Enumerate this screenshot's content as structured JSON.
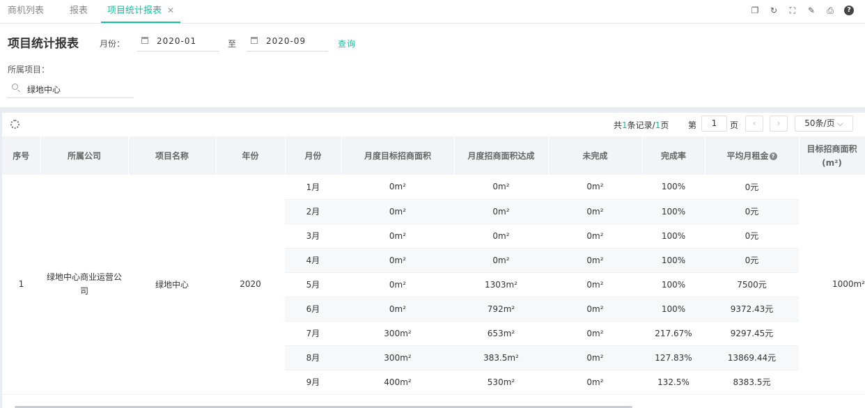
{
  "tabs": [
    {
      "label": "商机列表",
      "active": false
    },
    {
      "label": "报表",
      "active": false
    },
    {
      "label": "项目统计报表",
      "active": true
    }
  ],
  "toolbar_icons": [
    "copy-icon",
    "refresh-icon",
    "fullscreen-icon",
    "edit-icon",
    "print-icon",
    "help-icon"
  ],
  "filter": {
    "title": "项目统计报表",
    "month_label": "月份：",
    "start_month": "2020-01",
    "to_label": "至",
    "end_month": "2020-09",
    "query_label": "查询",
    "project_label": "所属项目：",
    "project_value": "绿地中心"
  },
  "pager": {
    "total_prefix": "共",
    "total_records": "1",
    "records_suffix": "条记录/",
    "total_pages": "1",
    "pages_suffix": "页",
    "page_prefix": "第",
    "current_page": "1",
    "page_suffix": "页",
    "page_size": "50条/页"
  },
  "columns": [
    "序号",
    "所属公司",
    "项目名称",
    "年份",
    "月份",
    "月度目标招商面积",
    "月度招商面积达成",
    "未完成",
    "完成率",
    "平均月租金",
    "目标招商面积(m²)"
  ],
  "group": {
    "index": "1",
    "company": "绿地中心商业运营公司",
    "project": "绿地中心",
    "year": "2020",
    "target_area": "1000m²"
  },
  "rows": [
    {
      "month": "1月",
      "target": "0m²",
      "achieved": "0m²",
      "unfinished": "0m²",
      "rate": "100%",
      "rent": "0元"
    },
    {
      "month": "2月",
      "target": "0m²",
      "achieved": "0m²",
      "unfinished": "0m²",
      "rate": "100%",
      "rent": "0元"
    },
    {
      "month": "3月",
      "target": "0m²",
      "achieved": "0m²",
      "unfinished": "0m²",
      "rate": "100%",
      "rent": "0元"
    },
    {
      "month": "4月",
      "target": "0m²",
      "achieved": "0m²",
      "unfinished": "0m²",
      "rate": "100%",
      "rent": "0元"
    },
    {
      "month": "5月",
      "target": "0m²",
      "achieved": "1303m²",
      "unfinished": "0m²",
      "rate": "100%",
      "rent": "7500元"
    },
    {
      "month": "6月",
      "target": "0m²",
      "achieved": "792m²",
      "unfinished": "0m²",
      "rate": "100%",
      "rent": "9372.43元"
    },
    {
      "month": "7月",
      "target": "300m²",
      "achieved": "653m²",
      "unfinished": "0m²",
      "rate": "217.67%",
      "rent": "9297.45元"
    },
    {
      "month": "8月",
      "target": "300m²",
      "achieved": "383.5m²",
      "unfinished": "0m²",
      "rate": "127.83%",
      "rent": "13869.44元"
    },
    {
      "month": "9月",
      "target": "400m²",
      "achieved": "530m²",
      "unfinished": "0m²",
      "rate": "132.5%",
      "rent": "8383.5元"
    }
  ]
}
